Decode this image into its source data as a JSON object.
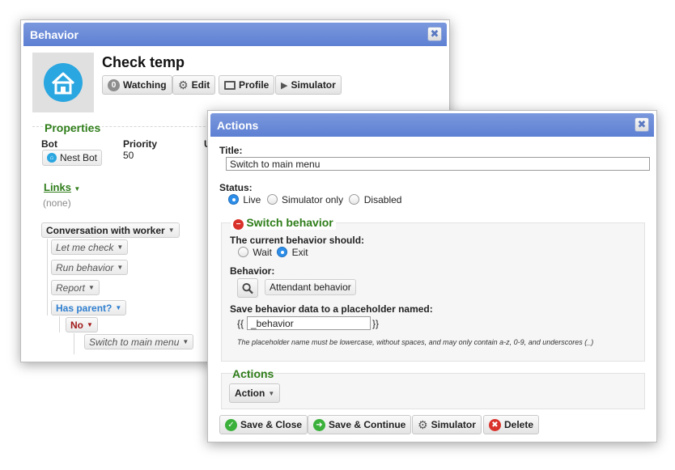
{
  "behavior_dialog": {
    "title": "Behavior",
    "close_glyph": "✖",
    "bot_name": "Check temp",
    "buttons": {
      "watching_count": "0",
      "watching": "Watching",
      "edit": "Edit",
      "profile": "Profile",
      "simulator": "Simulator"
    },
    "properties": {
      "heading": "Properties",
      "bot_label": "Bot",
      "bot_value": "Nest Bot",
      "priority_label": "Priority",
      "priority_value": "50",
      "partial_label": "U"
    },
    "links": {
      "heading": "Links",
      "value": "(none)"
    },
    "tree": {
      "root": "Conversation with worker",
      "items": [
        "Let me check",
        "Run behavior",
        "Report",
        "Has parent?"
      ],
      "branch": "No",
      "leaf": "Switch to main menu"
    }
  },
  "actions_dialog": {
    "title": "Actions",
    "close_glyph": "✖",
    "title_label": "Title:",
    "title_value": "Switch to main menu",
    "status_label": "Status:",
    "status_options": [
      "Live",
      "Simulator only",
      "Disabled"
    ],
    "status_selected": "Live",
    "switch_heading": "Switch behavior",
    "should_label": "The current behavior should:",
    "should_options": [
      "Wait",
      "Exit"
    ],
    "should_selected": "Exit",
    "behavior_label": "Behavior:",
    "behavior_value": "Attendant behavior",
    "placeholder_label": "Save behavior data to a placeholder named:",
    "brace_open": "{{",
    "placeholder_value": "_behavior",
    "brace_close": "}}",
    "hint": "The placeholder name must be lowercase, without spaces, and may only contain a-z, 0-9, and underscores (_)",
    "actions_heading": "Actions",
    "action_button": "Action",
    "footer": {
      "save_close": "Save & Close",
      "save_continue": "Save & Continue",
      "simulator": "Simulator",
      "delete": "Delete"
    }
  },
  "colors": {
    "titlebar": "#6a8ad7",
    "section_green": "#2f7d1a",
    "link_blue": "#2f7fd0",
    "branch_red": "#a11a1a",
    "radio_blue": "#2d8ee9",
    "delete_red": "#d9322b"
  }
}
